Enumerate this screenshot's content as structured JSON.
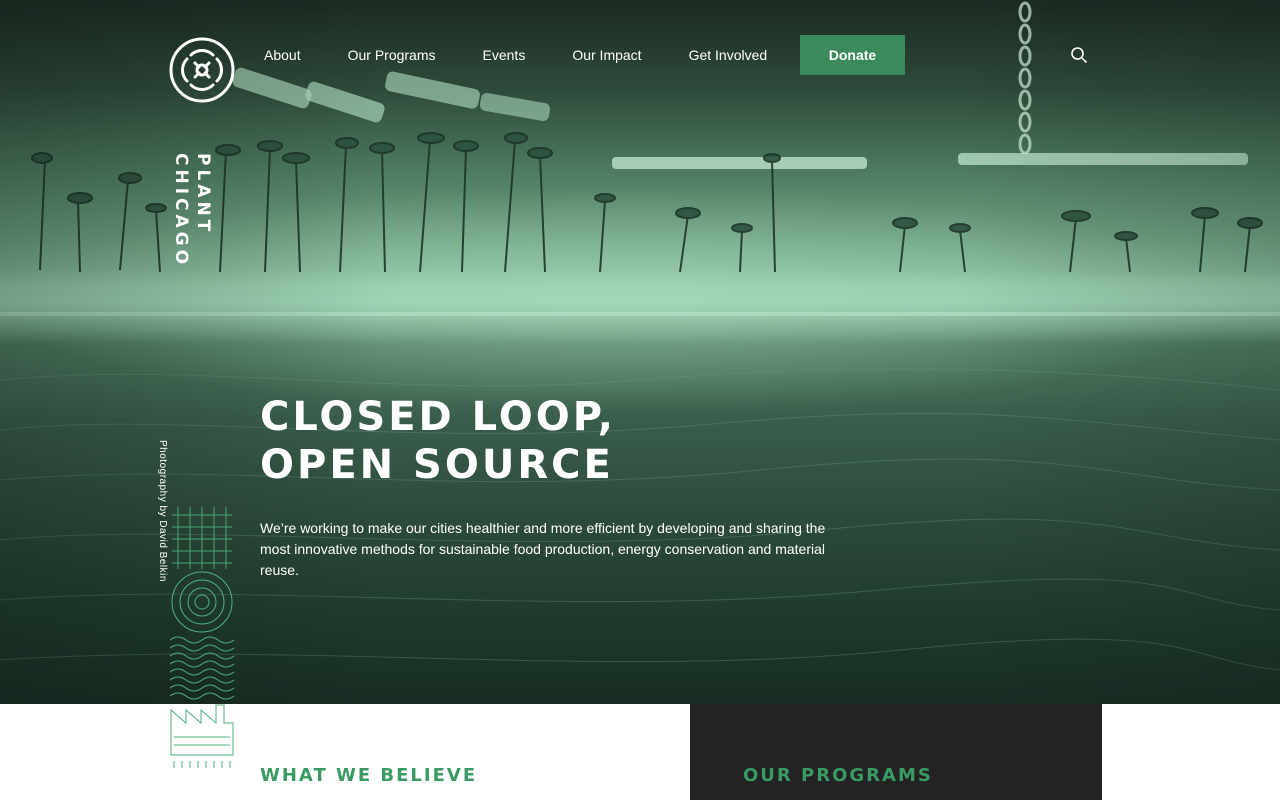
{
  "brand": {
    "name_line1": "PLANT",
    "name_line2": "CHICAGO",
    "accent_color": "#3a8a5c",
    "heading_color": "#3a9a64"
  },
  "nav": {
    "items": [
      {
        "label": "About"
      },
      {
        "label": "Our Programs"
      },
      {
        "label": "Events"
      },
      {
        "label": "Our Impact"
      },
      {
        "label": "Get Involved"
      }
    ],
    "donate_label": "Donate",
    "search_icon": "search-icon"
  },
  "hero": {
    "headline_line1": "CLOSED LOOP,",
    "headline_line2": "OPEN SOURCE",
    "intro": "We’re working to make our cities healthier and more efficient by developing and sharing the most innovative methods for sustainable food production, energy conservation and material reuse.",
    "photo_credit": "Photography by David Belkin"
  },
  "sections": {
    "believe_title": "WHAT WE BELIEVE",
    "programs_title": "OUR PROGRAMS"
  }
}
